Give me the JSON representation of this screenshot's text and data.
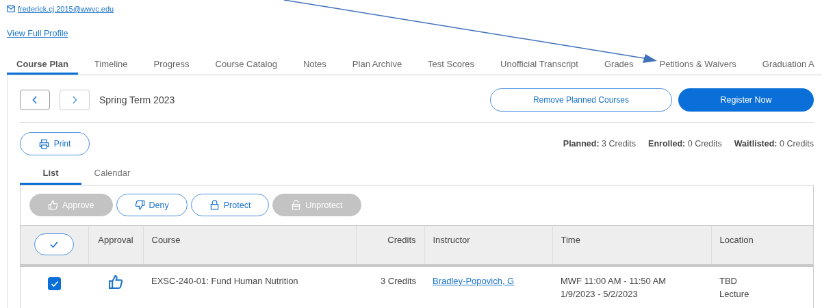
{
  "profile": {
    "email": "frederick.cj.2015@wwvc.edu",
    "link": "View Full Profile"
  },
  "tabs": [
    {
      "label": "Course Plan",
      "selected": true
    },
    {
      "label": "Timeline",
      "selected": false
    },
    {
      "label": "Progress",
      "selected": false
    },
    {
      "label": "Course Catalog",
      "selected": false
    },
    {
      "label": "Notes",
      "selected": false
    },
    {
      "label": "Plan Archive",
      "selected": false
    },
    {
      "label": "Test Scores",
      "selected": false
    },
    {
      "label": "Unofficial Transcript",
      "selected": false
    },
    {
      "label": "Grades",
      "selected": false
    },
    {
      "label": "Petitions & Waivers",
      "selected": false
    },
    {
      "label": "Graduation A",
      "selected": false
    }
  ],
  "term": {
    "title": "Spring Term 2023",
    "remove_button": "Remove Planned Courses",
    "register_button": "Register Now"
  },
  "print_button": "Print",
  "summary": [
    {
      "label": "Planned:",
      "value": "3 Credits"
    },
    {
      "label": "Enrolled:",
      "value": "0 Credits"
    },
    {
      "label": "Waitlisted:",
      "value": "0 Credits"
    }
  ],
  "view_tabs": [
    {
      "label": "List",
      "selected": true
    },
    {
      "label": "Calendar",
      "selected": false
    }
  ],
  "actions": [
    {
      "kind": "approve",
      "label": "Approve",
      "disabled": true
    },
    {
      "kind": "deny",
      "label": "Deny",
      "disabled": false
    },
    {
      "kind": "protect",
      "label": "Protect",
      "disabled": false
    },
    {
      "kind": "unprotect",
      "label": "Unprotect",
      "disabled": true
    }
  ],
  "table": {
    "columns": [
      "Approval",
      "Course",
      "Credits",
      "Instructor",
      "Time",
      "Location"
    ],
    "rows": [
      {
        "checked": true,
        "approved": true,
        "course": "EXSC-240-01: Fund Human Nutrition",
        "credits": "3 Credits",
        "instructor": "Bradley-Popovich, G",
        "time": [
          "MWF 11:00 AM - 11:50 AM",
          "1/9/2023 - 5/2/2023"
        ],
        "location": [
          "TBD",
          "Lecture"
        ]
      }
    ]
  }
}
